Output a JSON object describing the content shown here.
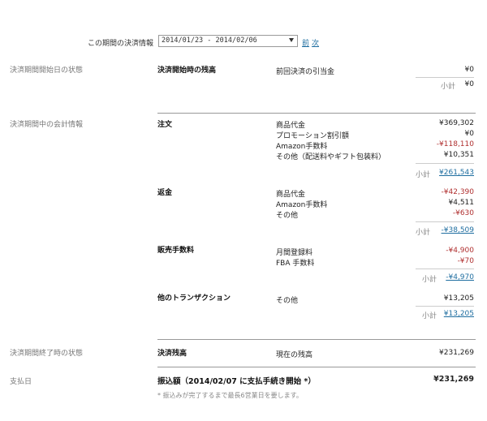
{
  "period": {
    "label": "この期間の決済情報",
    "selected": "2014/01/23 - 2014/02/06",
    "prev_link": "前",
    "next_link": "次"
  },
  "start": {
    "section_label": "決済期間開始日の状態",
    "heading": "決済開始時の残高",
    "item_label": "前回決済の引当金",
    "item_value": "¥0",
    "subtotal_label": "小計",
    "subtotal_value": "¥0"
  },
  "accounting": {
    "section_label": "決済期間中の会計情報",
    "orders": {
      "heading": "注文",
      "items": [
        {
          "label": "商品代金",
          "value": "¥369,302",
          "negative": false
        },
        {
          "label": "プロモーション割引額",
          "value": "¥0",
          "negative": false
        },
        {
          "label": "Amazon手数料",
          "value": "-¥118,110",
          "negative": true
        },
        {
          "label": "その他（配送料やギフト包装料）",
          "value": "¥10,351",
          "negative": false
        }
      ],
      "subtotal_label": "小計",
      "subtotal_value": "¥261,543"
    },
    "refunds": {
      "heading": "返金",
      "items": [
        {
          "label": "商品代金",
          "value": "-¥42,390",
          "negative": true
        },
        {
          "label": "Amazon手数料",
          "value": "¥4,511",
          "negative": false
        },
        {
          "label": "その他",
          "value": "-¥630",
          "negative": true
        }
      ],
      "subtotal_label": "小計",
      "subtotal_value": "-¥38,509"
    },
    "sales_fees": {
      "heading": "販売手数料",
      "items": [
        {
          "label": "月間登録料",
          "value": "-¥4,900",
          "negative": true
        },
        {
          "label": "FBA 手数料",
          "value": "-¥70",
          "negative": true
        }
      ],
      "subtotal_label": "小計",
      "subtotal_value": "-¥4,970"
    },
    "other": {
      "heading": "他のトランザクション",
      "items": [
        {
          "label": "その他",
          "value": "¥13,205",
          "negative": false
        }
      ],
      "subtotal_label": "小計",
      "subtotal_value": "¥13,205"
    }
  },
  "end": {
    "section_label": "決済期間終了時の状態",
    "heading": "決済残高",
    "item_label": "現在の残高",
    "item_value": "¥231,269"
  },
  "payment": {
    "section_label": "支払日",
    "heading": "振込額（2014/02/07 に支払手続き開始 *）",
    "value": "¥231,269",
    "note": "* 振込みが完了するまで最長6営業日を要します。"
  }
}
